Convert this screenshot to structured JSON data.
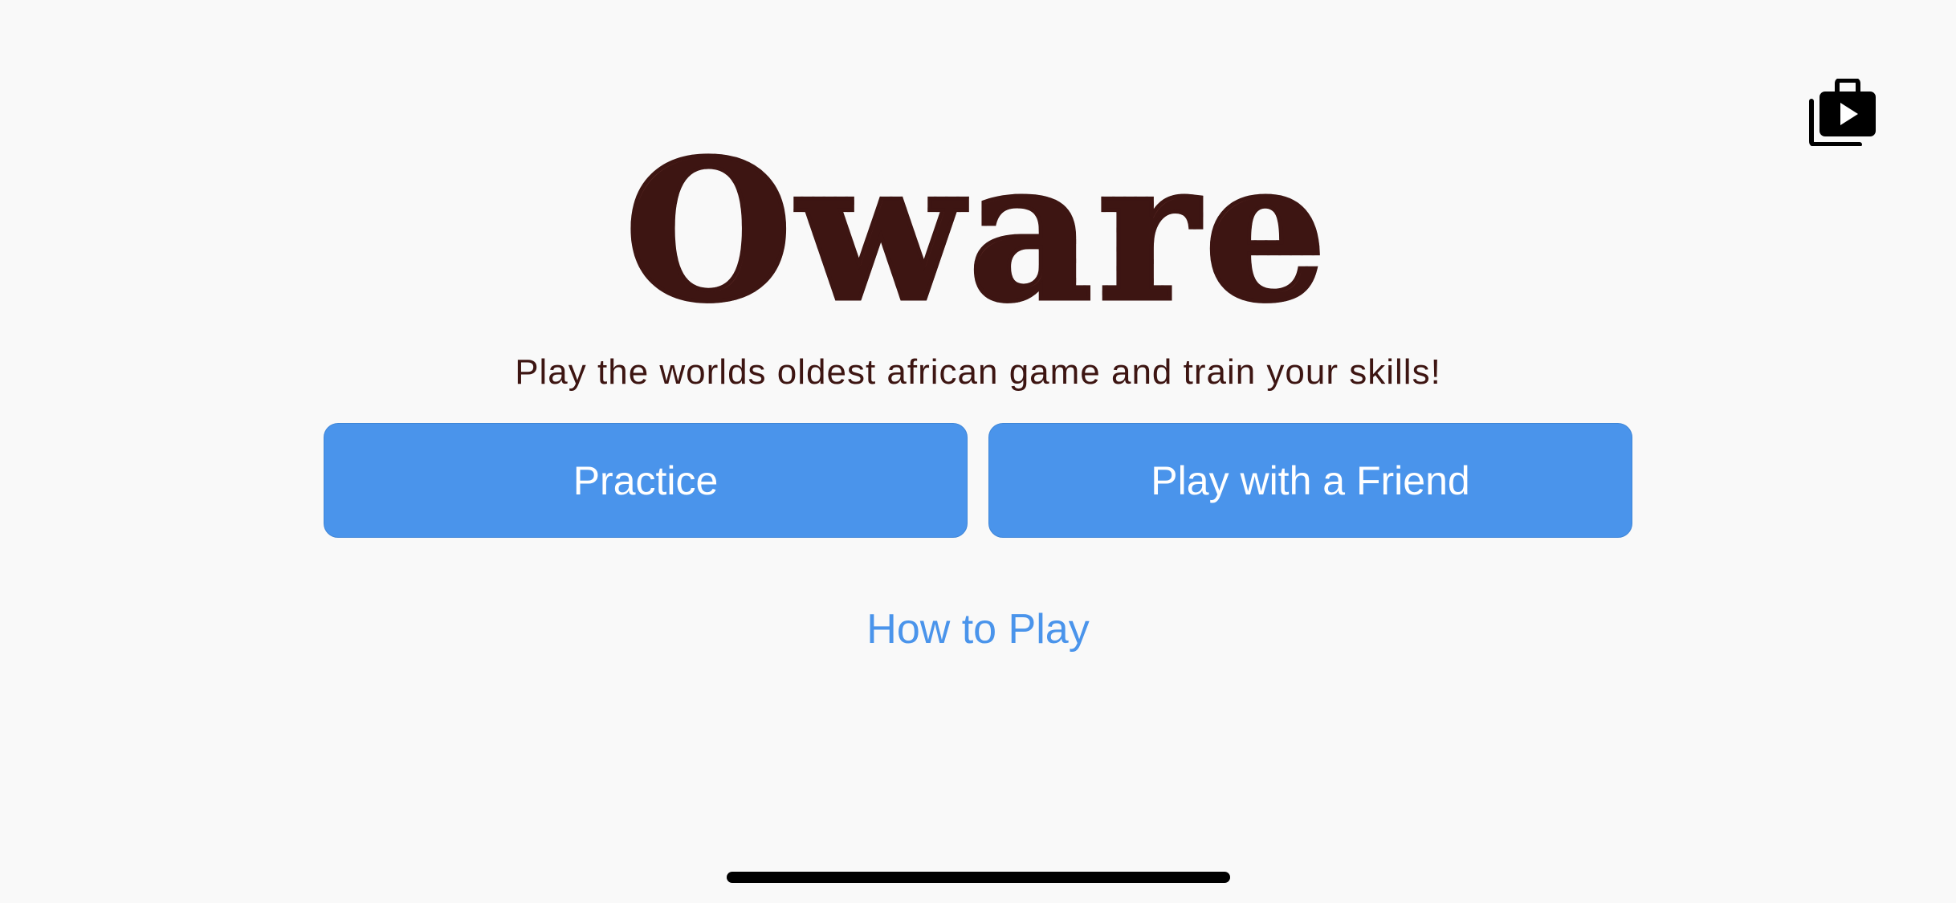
{
  "app": {
    "title": "Oware",
    "subtitle": "Play the worlds oldest african game and train your skills!"
  },
  "buttons": {
    "practice_label": "Practice",
    "friend_label": "Play with a Friend"
  },
  "links": {
    "how_to_play": "How to Play"
  },
  "icons": {
    "top_right": "media-briefcase-play-icon"
  },
  "colors": {
    "background": "#f9f9f9",
    "button": "#4a94eb",
    "button_text": "#ffffff",
    "title": "#3d1512",
    "link": "#4a94eb"
  }
}
